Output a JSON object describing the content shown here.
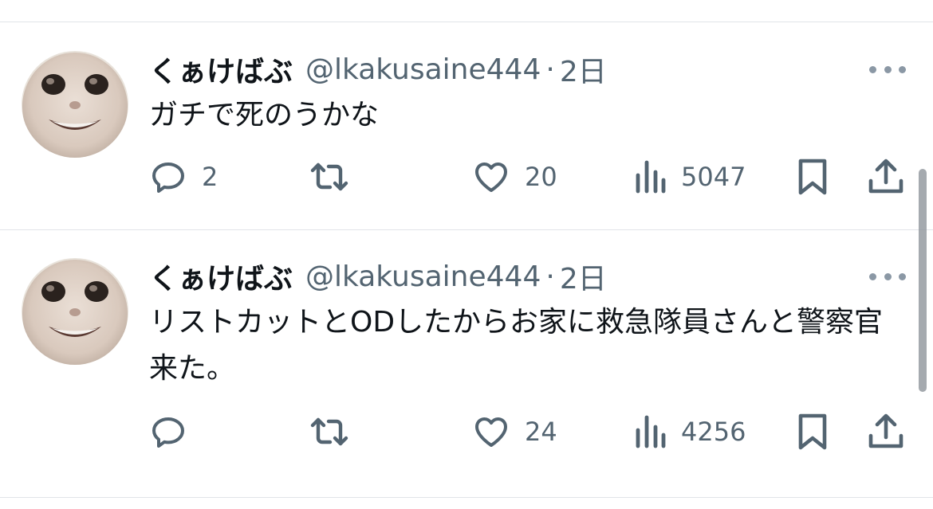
{
  "tweets": [
    {
      "name": "くぁけばぶ",
      "handle": "@lkakusaine444",
      "separator": "·",
      "time": "2日",
      "text": "ガチで死のうかな",
      "reply_count": "2",
      "retweet_count": "",
      "like_count": "20",
      "views_count": "5047"
    },
    {
      "name": "くぁけばぶ",
      "handle": "@lkakusaine444",
      "separator": "·",
      "time": "2日",
      "text": "リストカットとODしたからお家に救急隊員さんと警察官来た。",
      "reply_count": "",
      "retweet_count": "",
      "like_count": "24",
      "views_count": "4256"
    }
  ],
  "icons": {
    "reply": "speech-bubble",
    "retweet": "two-arrows-loop",
    "like": "heart",
    "views": "bar-chart",
    "bookmark": "bookmark",
    "share": "upload-arrow",
    "more": "three-dots"
  },
  "colors": {
    "text": "#0f1419",
    "secondary": "#536471",
    "divider": "#e1e4e8"
  }
}
